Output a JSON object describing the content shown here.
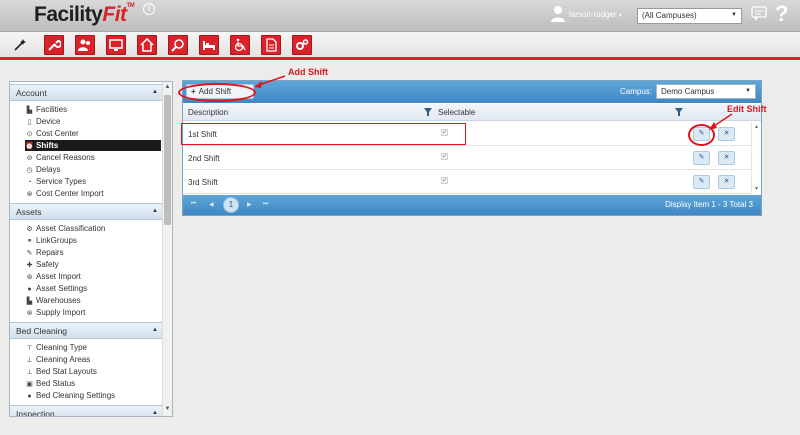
{
  "header": {
    "logo_main": "Facility",
    "logo_accent": "Fit",
    "logo_tm": "TM",
    "info_glyph": "i",
    "username": "larson-rodger",
    "username_caret": "▾",
    "campus_select": "(All Campuses)",
    "help_glyph": "?",
    "caret": "▼"
  },
  "toolbar": {
    "icons": [
      "settings-wand-icon",
      "wrench-icon",
      "people-icon",
      "monitor-icon",
      "home-icon",
      "magnifier-icon",
      "bed-icon",
      "wheelchair-icon",
      "document-icon",
      "gears-icon"
    ]
  },
  "sidebar": {
    "collapse_glyph": "▲",
    "scroll_down_glyph": "▼",
    "sections": [
      {
        "title": "Account"
      },
      {
        "title": "Assets"
      },
      {
        "title": "Bed Cleaning"
      },
      {
        "title": "Inspection"
      }
    ],
    "account_items": [
      {
        "label": "Facilities",
        "glyph": "▙"
      },
      {
        "label": "Device",
        "glyph": "▯"
      },
      {
        "label": "Cost Center",
        "glyph": "⊙"
      },
      {
        "label": "Shifts",
        "glyph": "⏰"
      },
      {
        "label": "Cancel Reasons",
        "glyph": "⊘"
      },
      {
        "label": "Delays",
        "glyph": "◷"
      },
      {
        "label": "Service Types",
        "glyph": "◔"
      },
      {
        "label": "Cost Center Import",
        "glyph": "⊛"
      }
    ],
    "asset_items": [
      {
        "label": "Asset Classification",
        "glyph": "⚙"
      },
      {
        "label": "LinkGroups",
        "glyph": "⚭"
      },
      {
        "label": "Repairs",
        "glyph": "✎"
      },
      {
        "label": "Safety",
        "glyph": "✚"
      },
      {
        "label": "Asset Import",
        "glyph": "⊛"
      },
      {
        "label": "Asset Settings",
        "glyph": "●"
      },
      {
        "label": "Warehouses",
        "glyph": "▙"
      },
      {
        "label": "Supply Import",
        "glyph": "⊛"
      }
    ],
    "bed_items": [
      {
        "label": "Cleaning Type",
        "glyph": "⊤"
      },
      {
        "label": "Cleaning Areas",
        "glyph": "⊥"
      },
      {
        "label": "Bed Stat Layouts",
        "glyph": "⊥"
      },
      {
        "label": "Bed Status",
        "glyph": "▣"
      },
      {
        "label": "Bed Cleaning Settings",
        "glyph": "●"
      }
    ]
  },
  "grid": {
    "add_plus": "+",
    "add_label": "Add Shift",
    "campus_label": "Campus:",
    "campus_value": "Demo Campus",
    "columns": [
      "Description",
      "Selectable"
    ],
    "rows": [
      {
        "description": "1st Shift",
        "selectable": true
      },
      {
        "description": "2nd Shift",
        "selectable": true
      },
      {
        "description": "3rd Shift",
        "selectable": true
      }
    ],
    "check_glyph": "✔",
    "edit_glyph": "✎",
    "delete_glyph": "✕",
    "scroll_up_glyph": "▲",
    "scroll_down_glyph": "▼",
    "pager": {
      "first_glyph": "⏮",
      "prev_glyph": "◀",
      "page": "1",
      "next_glyph": "▶",
      "last_glyph": "⏭",
      "info": "Display Item 1 - 3 Total 3"
    }
  },
  "annotations": {
    "add_shift": "Add Shift",
    "edit_shift": "Edit Shift"
  },
  "colors": {
    "brand_red": "#d8232a",
    "grid_blue": "#4a93cc",
    "annotation_red": "#e0141c"
  }
}
